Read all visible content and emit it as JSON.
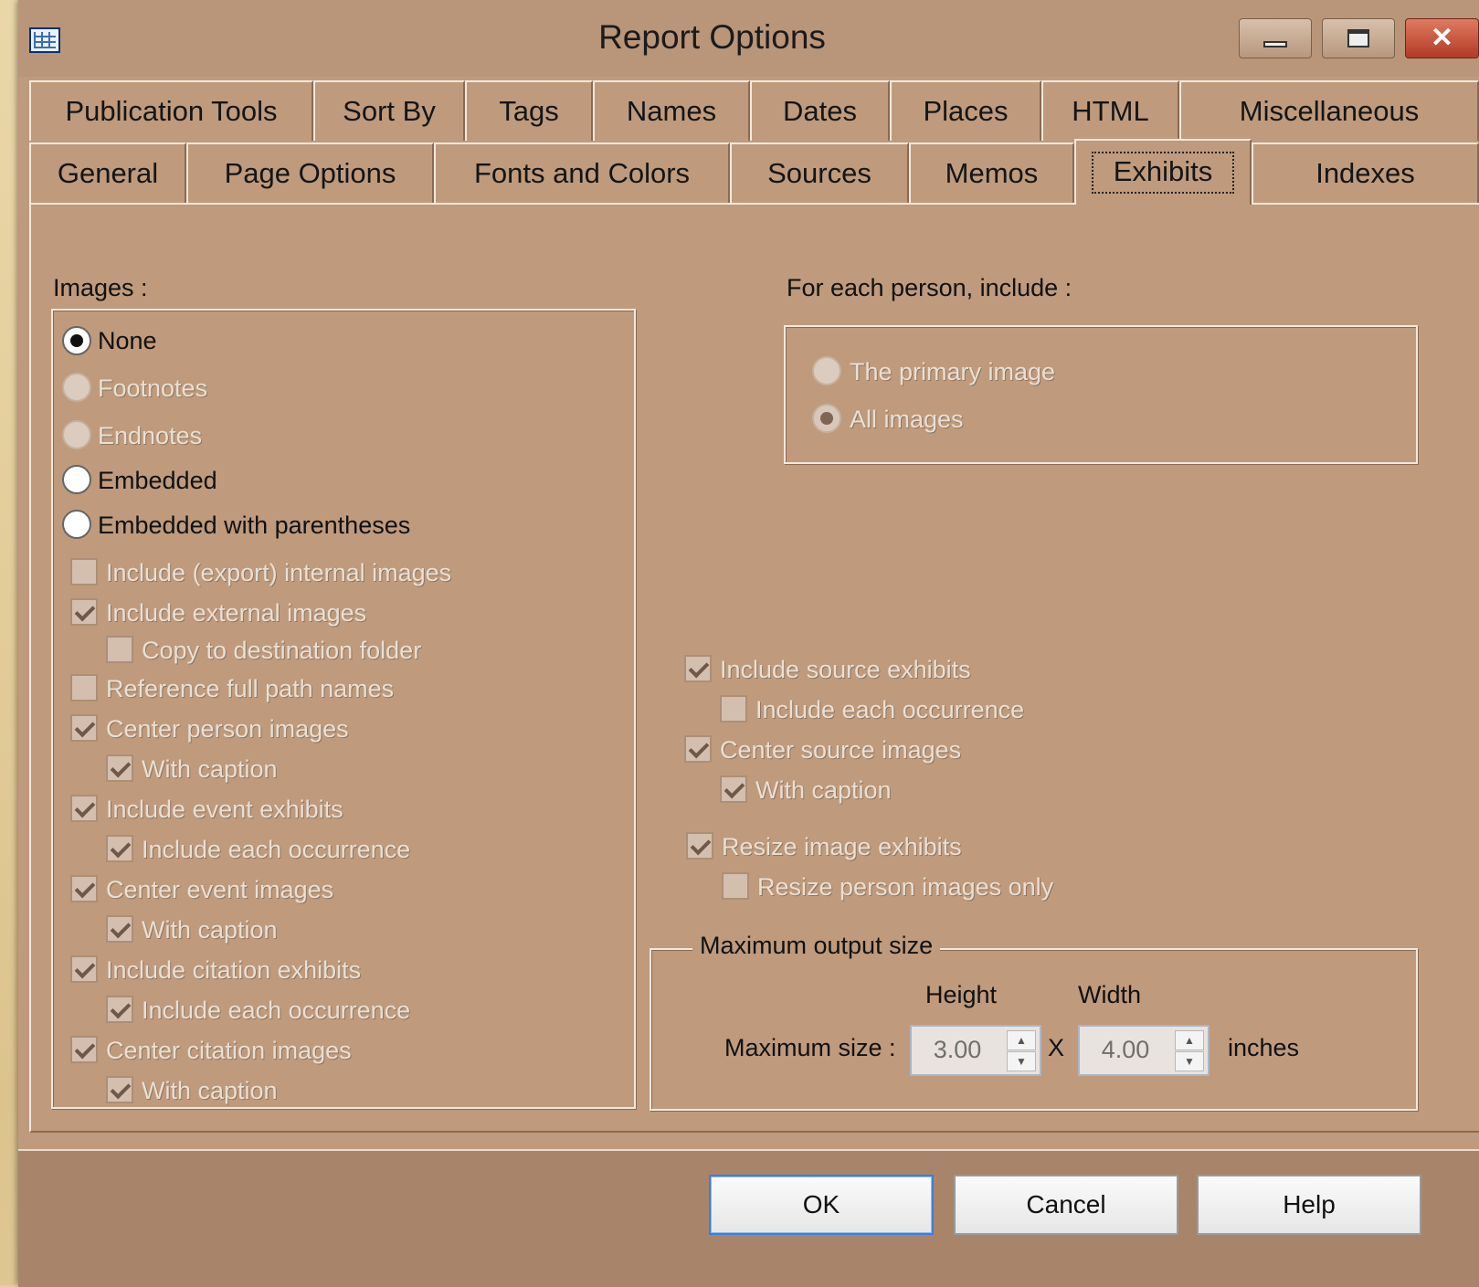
{
  "window": {
    "title": "Report Options",
    "app_icon": "report-grid-icon",
    "controls": [
      "minimize-icon",
      "maximize-icon",
      "close-icon"
    ]
  },
  "tabs": {
    "row1": [
      "Publication Tools",
      "Sort By",
      "Tags",
      "Names",
      "Dates",
      "Places",
      "HTML",
      "Miscellaneous"
    ],
    "row2": [
      "General",
      "Page Options",
      "Fonts and Colors",
      "Sources",
      "Memos",
      "Exhibits",
      "Indexes"
    ],
    "selected": "Exhibits"
  },
  "images": {
    "label": "Images :",
    "options": [
      {
        "label": "None",
        "checked": true,
        "enabled": true
      },
      {
        "label": "Footnotes",
        "checked": false,
        "enabled": false
      },
      {
        "label": "Endnotes",
        "checked": false,
        "enabled": false
      },
      {
        "label": "Embedded",
        "checked": false,
        "enabled": true
      },
      {
        "label": "Embedded with parentheses",
        "checked": false,
        "enabled": true
      }
    ],
    "checkboxes": [
      {
        "label": "Include (export) internal images",
        "checked": false
      },
      {
        "label": "Include external images",
        "checked": true
      },
      {
        "label": "Copy to destination folder",
        "checked": false
      },
      {
        "label": "Reference full path names",
        "checked": false
      },
      {
        "label": "Center person images",
        "checked": true
      },
      {
        "label": "With caption",
        "checked": true
      },
      {
        "label": "Include event exhibits",
        "checked": true
      },
      {
        "label": "Include each occurrence",
        "checked": true
      },
      {
        "label": "Center event images",
        "checked": true
      },
      {
        "label": "With caption",
        "checked": true
      },
      {
        "label": "Include citation exhibits",
        "checked": true
      },
      {
        "label": "Include each occurrence",
        "checked": true
      },
      {
        "label": "Center citation images",
        "checked": true
      },
      {
        "label": "With caption",
        "checked": true
      }
    ]
  },
  "person": {
    "label": "For each person, include :",
    "options": [
      {
        "label": "The primary image",
        "checked": false
      },
      {
        "label": "All images",
        "checked": true
      }
    ]
  },
  "source": {
    "checkboxes": [
      {
        "label": "Include source exhibits",
        "checked": true
      },
      {
        "label": "Include each occurrence",
        "checked": false
      },
      {
        "label": "Center source images",
        "checked": true
      },
      {
        "label": "With caption",
        "checked": true
      },
      {
        "label": "Resize image exhibits",
        "checked": true
      },
      {
        "label": "Resize person images only",
        "checked": false
      }
    ]
  },
  "max_output": {
    "title": "Maximum output size",
    "height_label": "Height",
    "width_label": "Width",
    "size_label": "Maximum size :",
    "height_value": "3.00",
    "times": "X",
    "width_value": "4.00",
    "unit": "inches"
  },
  "buttons": {
    "ok": "OK",
    "cancel": "Cancel",
    "help": "Help"
  }
}
